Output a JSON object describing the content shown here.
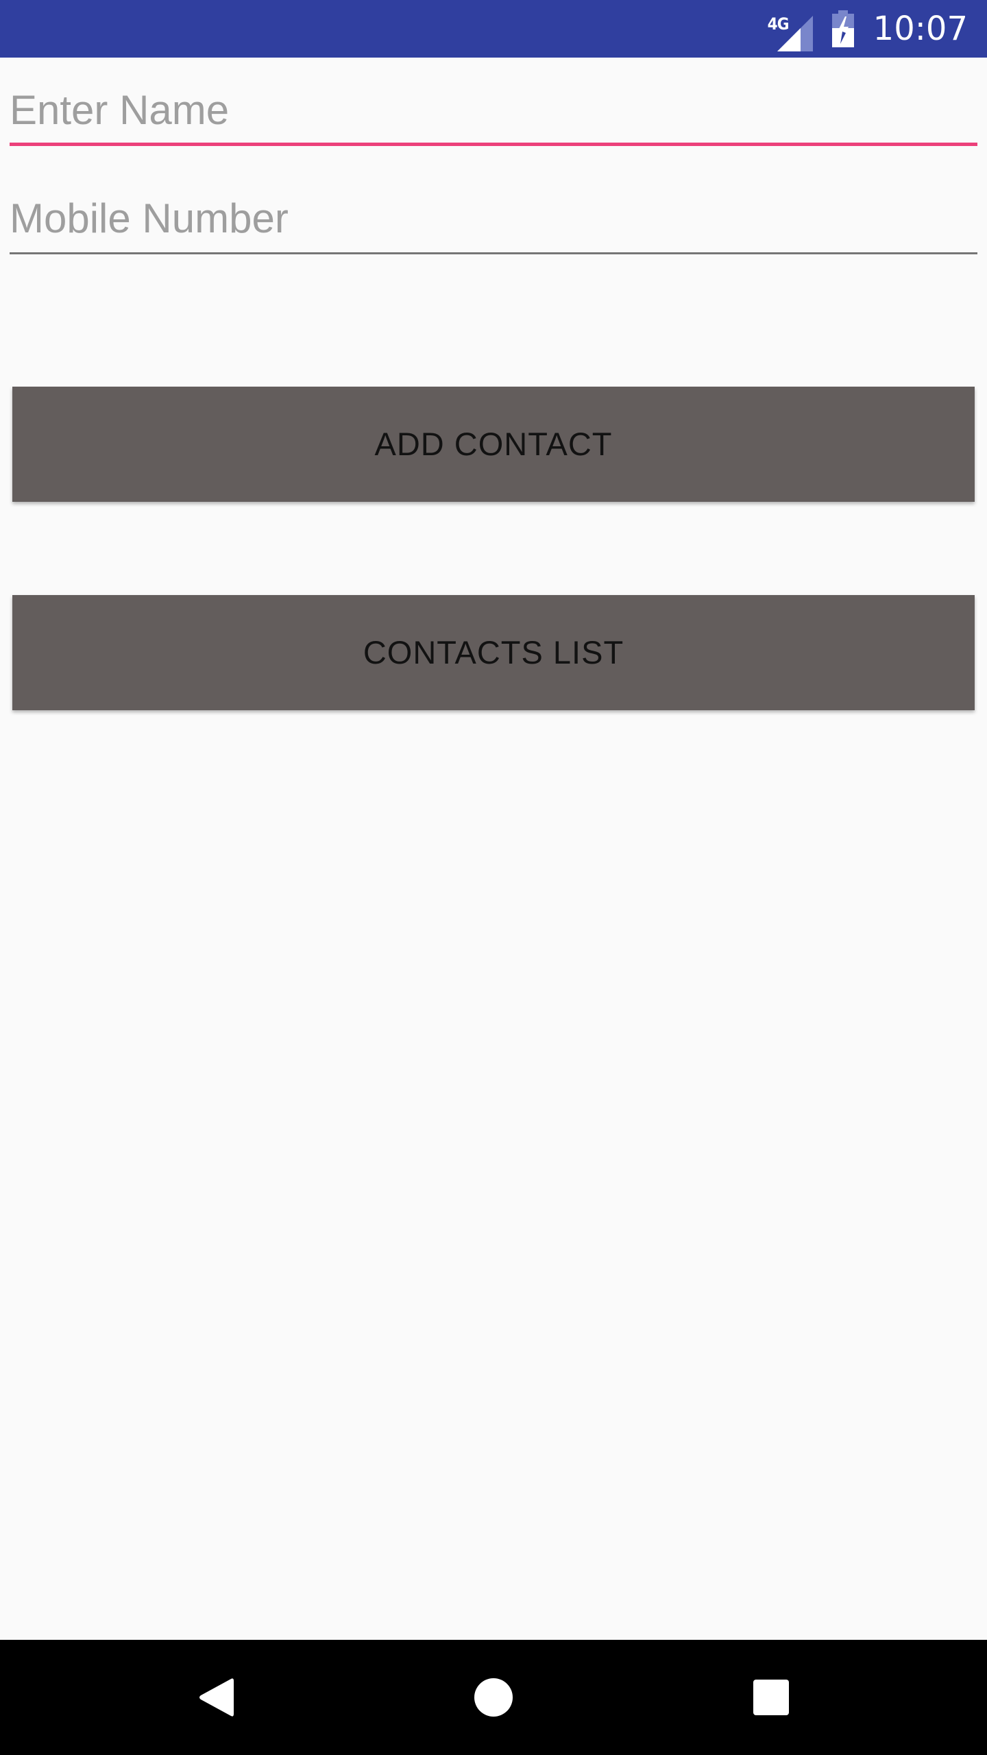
{
  "status_bar": {
    "network_type": "4G",
    "time": "10:07",
    "icons": [
      "cellular-signal-icon",
      "battery-charging-icon"
    ],
    "background_color": "#303f9f"
  },
  "form": {
    "name_field": {
      "value": "",
      "placeholder": "Enter Name",
      "focused": true,
      "accent_color": "#ec407a"
    },
    "mobile_field": {
      "value": "",
      "placeholder": "Mobile Number"
    }
  },
  "buttons": {
    "add_contact_label": "ADD CONTACT",
    "contacts_list_label": "CONTACTS LIST",
    "background_color": "#635d5c"
  },
  "navigation_bar": {
    "icons": [
      "back-icon",
      "home-icon",
      "recents-icon"
    ]
  }
}
